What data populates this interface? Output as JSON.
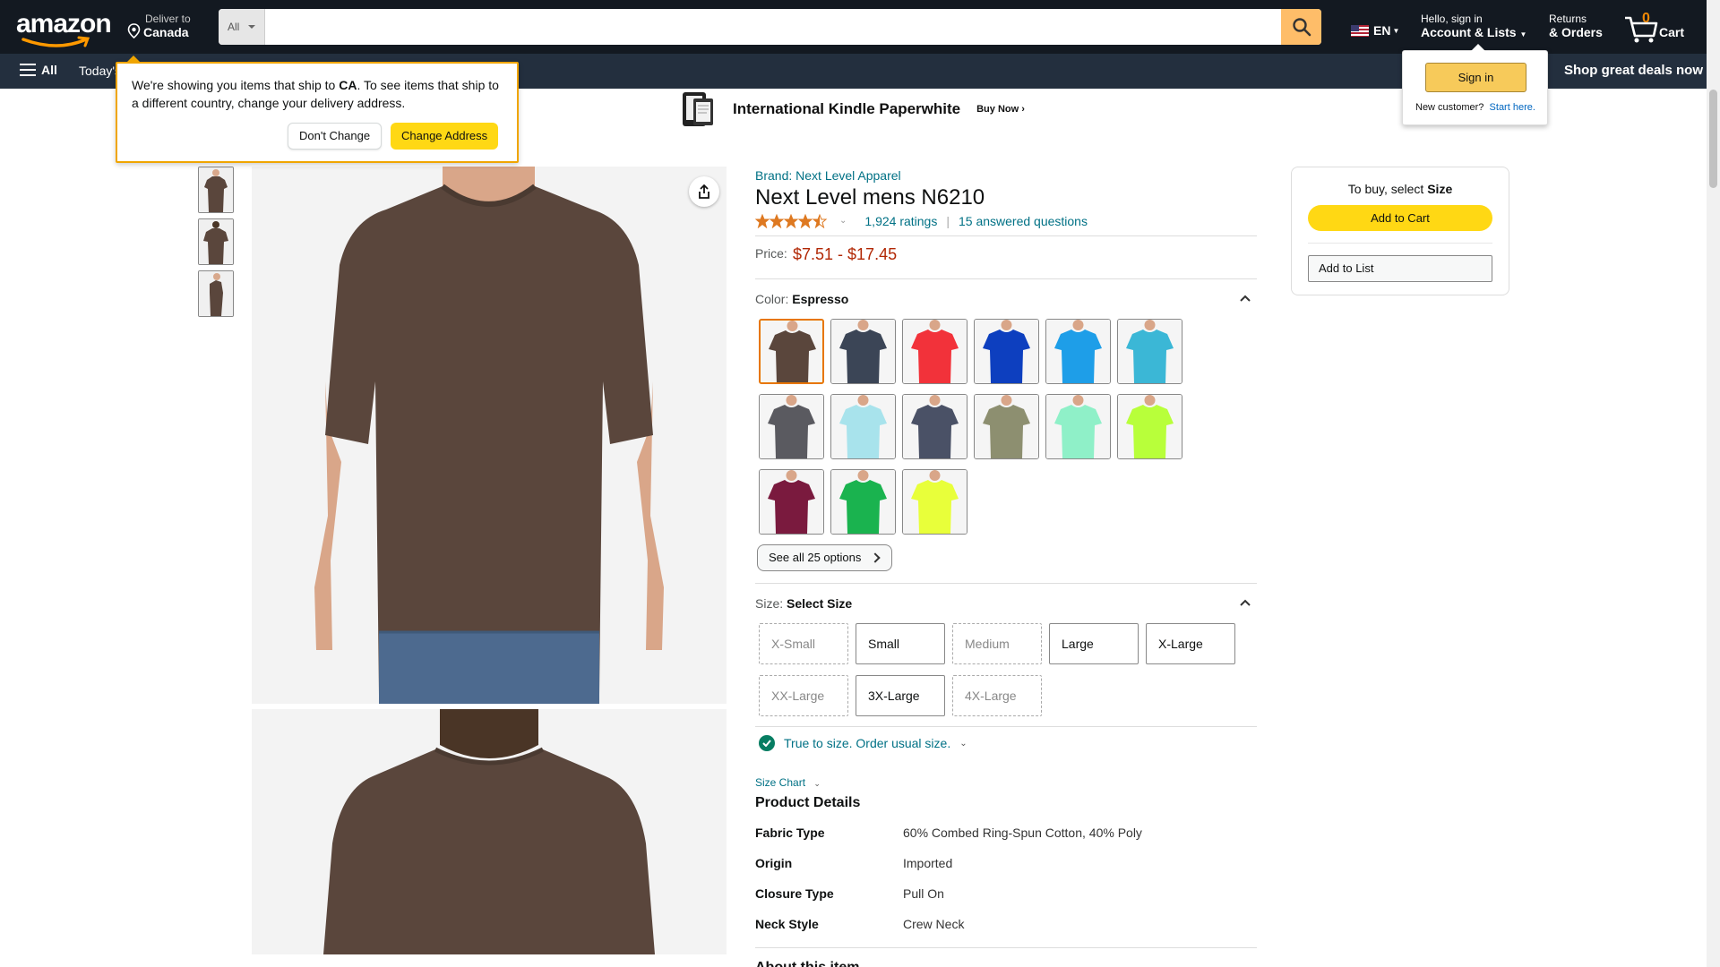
{
  "header": {
    "logo": "amazon",
    "deliver_line1": "Deliver to",
    "deliver_line2": "Canada",
    "search_category": "All",
    "search_placeholder": "",
    "language": "EN",
    "account_line1": "Hello, sign in",
    "account_line2": "Account & Lists",
    "returns_line1": "Returns",
    "returns_line2": "& Orders",
    "cart_count": "0",
    "cart_label": "Cart"
  },
  "navbar": {
    "all_label": "All",
    "today_label": "Today's Deals",
    "deals_label": "Shop great deals now"
  },
  "banner": {
    "title": "International Kindle Paperwhite",
    "cta": "Buy Now"
  },
  "ship_popover": {
    "text_before": "We're showing you items that ship to ",
    "country": "CA",
    "text_after": ". To see items that ship to a different country, change your delivery address.",
    "dont_change": "Don't Change",
    "change_address": "Change Address"
  },
  "signin_popover": {
    "button": "Sign in",
    "new_customer": "New customer?",
    "start_here": "Start here."
  },
  "product": {
    "brand": "Brand: Next Level Apparel",
    "title": "Next Level mens N6210",
    "rating_value": 4.5,
    "ratings_count": "1,924 ratings",
    "questions": "15 answered questions",
    "price_label": "Price:",
    "price_range": "$7.51 - $17.45",
    "color_label": "Color:",
    "color_value": "Espresso",
    "see_all": "See all 25 options",
    "size_label": "Size:",
    "size_value": "Select Size",
    "fit_text": "True to size. Order usual size.",
    "size_chart": "Size Chart",
    "details_title": "Product Details",
    "about_title": "About this item"
  },
  "swatch_colors": [
    "#5a463c",
    "#3b4556",
    "#f2323a",
    "#0d3fbf",
    "#1e9ee8",
    "#3bb7d6",
    "#5a5a60",
    "#a8e3ec",
    "#4a5166",
    "#8d8f70",
    "#8ff0c8",
    "#b8ff3a",
    "#7a1a3e",
    "#1ab34f",
    "#e8ff3a"
  ],
  "sizes": [
    {
      "label": "X-Small",
      "available": false
    },
    {
      "label": "Small",
      "available": true
    },
    {
      "label": "Medium",
      "available": false
    },
    {
      "label": "Large",
      "available": true
    },
    {
      "label": "X-Large",
      "available": true
    },
    {
      "label": "XX-Large",
      "available": false
    },
    {
      "label": "3X-Large",
      "available": true
    },
    {
      "label": "4X-Large",
      "available": false
    }
  ],
  "details": [
    {
      "key": "Fabric Type",
      "value": "60% Combed Ring-Spun Cotton, 40% Poly"
    },
    {
      "key": "Origin",
      "value": "Imported"
    },
    {
      "key": "Closure Type",
      "value": "Pull On"
    },
    {
      "key": "Neck Style",
      "value": "Crew Neck"
    }
  ],
  "buybox": {
    "select_prefix": "To buy, select ",
    "select_bold": "Size",
    "add_to_cart": "Add to Cart",
    "add_to_list": "Add to List"
  },
  "colors": {
    "header_bg": "#131921",
    "nav_bg": "#232f3e",
    "search_btn": "#febd69",
    "link": "#007185",
    "price": "#b12704",
    "add_to_cart": "#ffd814",
    "shirt": "#5a463c"
  }
}
